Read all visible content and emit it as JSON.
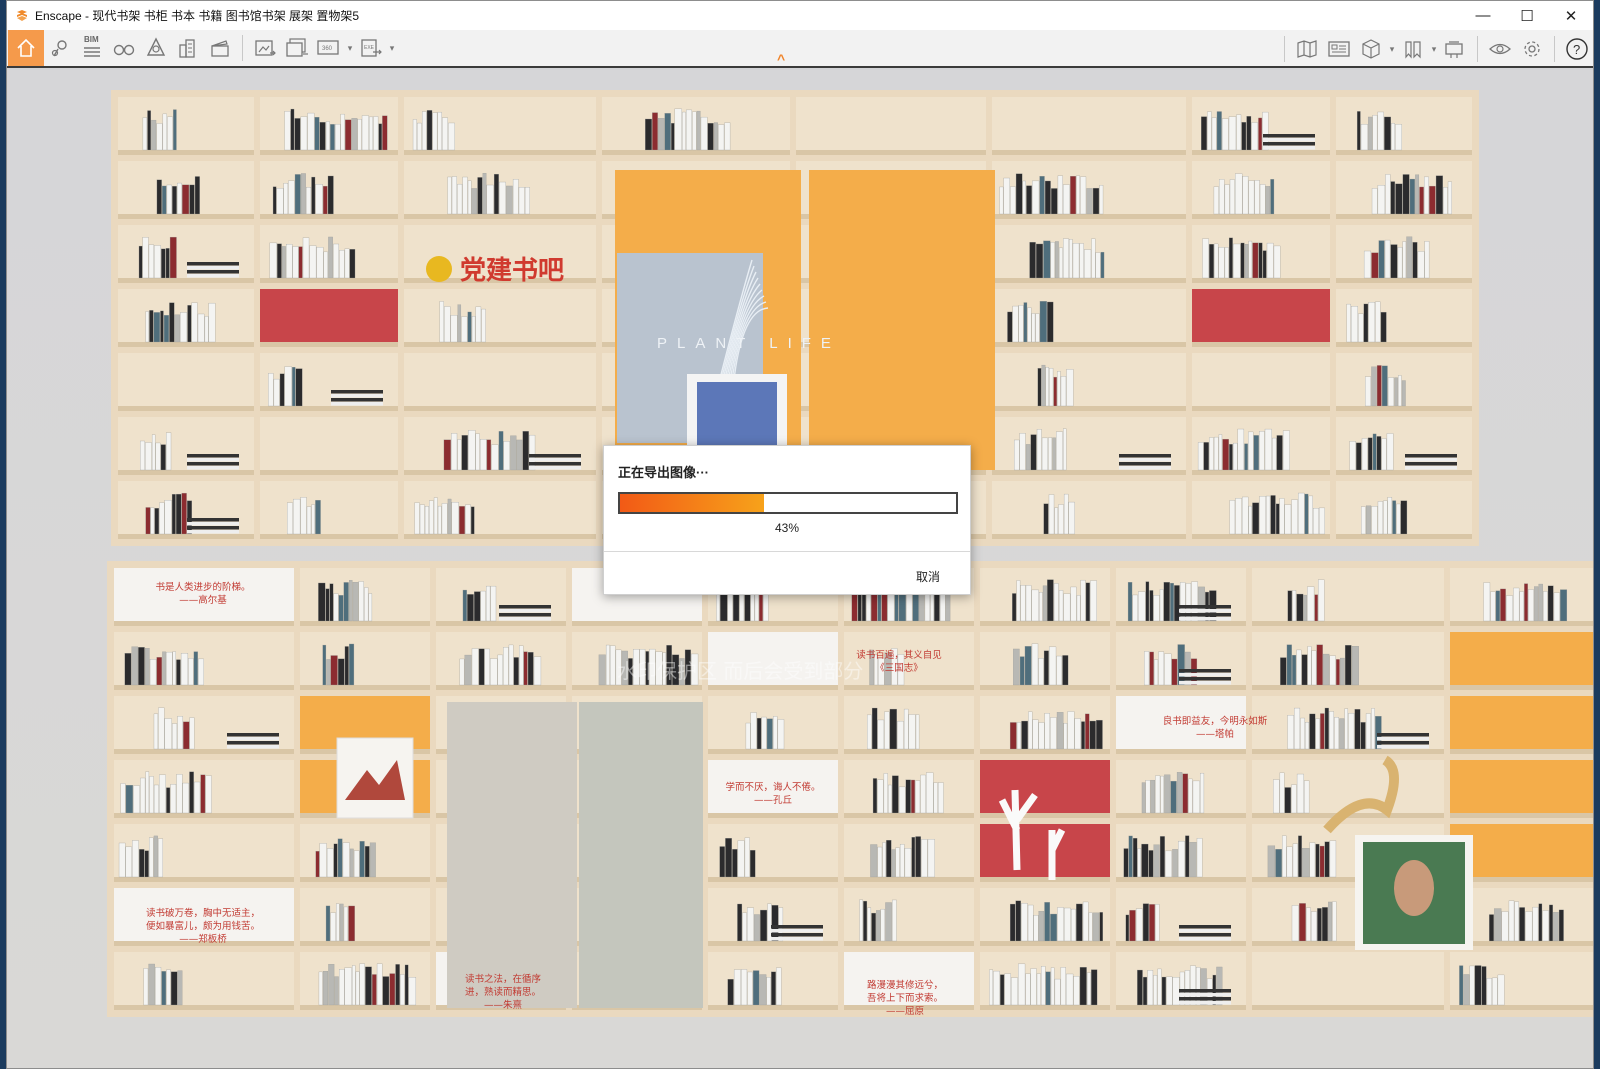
{
  "app": {
    "title": "Enscape - 现代书架 书柜 书本 书籍 图书馆书架 展架 置物架5"
  },
  "window_controls": {
    "minimize": "—",
    "maximize": "☐",
    "close": "✕"
  },
  "toolbar": {
    "bim_label": "BIM",
    "left_icons": [
      "home-icon",
      "location-pin-icon",
      "bim-list-icon",
      "binoculars-icon",
      "asset-library-icon",
      "buildings-icon",
      "clapperboard-icon",
      "screenshot-icon",
      "batch-render-icon",
      "panorama-360-icon",
      "export-exe-icon"
    ],
    "right_icons": [
      "map-icon",
      "views-icon",
      "cube-icon",
      "bookmark-icon",
      "capture-icon",
      "eye-icon",
      "gear-icon",
      "help-icon"
    ],
    "collapse_arrow": "^"
  },
  "scene": {
    "party_sign": "党建书吧",
    "poster_text": "PLANT LIFE",
    "quotes": [
      {
        "line1": "书是人类进步的阶梯。",
        "line2": "——高尔基"
      },
      {
        "line1": "读书百遍，其义自见",
        "line2": "《三国志》"
      },
      {
        "line1": "良书即益友，今明永如斯",
        "line2": "——塔帕"
      },
      {
        "line1": "学而不厌，诲人不倦。",
        "line2": "——孔丘"
      },
      {
        "line1": "读书破万卷，胸中无适主，",
        "line2": "便如暴富儿，颇为用钱苦。",
        "line3": "——郑板桥"
      },
      {
        "line1": "读书之法，在循序",
        "line2": "进，熟读而精思。",
        "line3": "——朱熹"
      },
      {
        "line1": "路漫漫其修远兮，",
        "line2": "吾将上下而求索。",
        "line3": "——屈原"
      }
    ],
    "watermark": "水印保护区 而后会受到部分"
  },
  "export_dialog": {
    "title": "正在导出图像···",
    "progress": 0.43,
    "progress_label": "43%",
    "cancel_label": "取消"
  },
  "colors": {
    "accent": "#f59a4b",
    "progress_start": "#f25a16",
    "progress_end": "#f7a21a",
    "shelf_wood": "#e7d8bf",
    "red_panel": "#c8454a",
    "yellow_panel": "#f4ad4a"
  }
}
